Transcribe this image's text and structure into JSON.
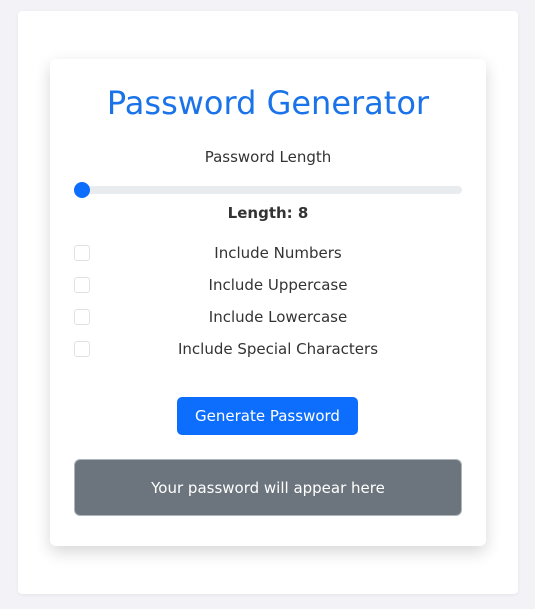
{
  "app": {
    "title": "Password Generator",
    "accent_color": "#1a73e8",
    "button_color": "#0d6efd",
    "output_bg_color": "#6c757d"
  },
  "length": {
    "label": "Password Length",
    "value_text": "Length: 8",
    "slider_fraction": 0.0
  },
  "options": [
    {
      "label": "Include Numbers",
      "checked": false
    },
    {
      "label": "Include Uppercase",
      "checked": false
    },
    {
      "label": "Include Lowercase",
      "checked": false
    },
    {
      "label": "Include Special Characters",
      "checked": false
    }
  ],
  "generate_button": {
    "label": "Generate Password"
  },
  "output": {
    "placeholder_text": "Your password will appear here"
  }
}
